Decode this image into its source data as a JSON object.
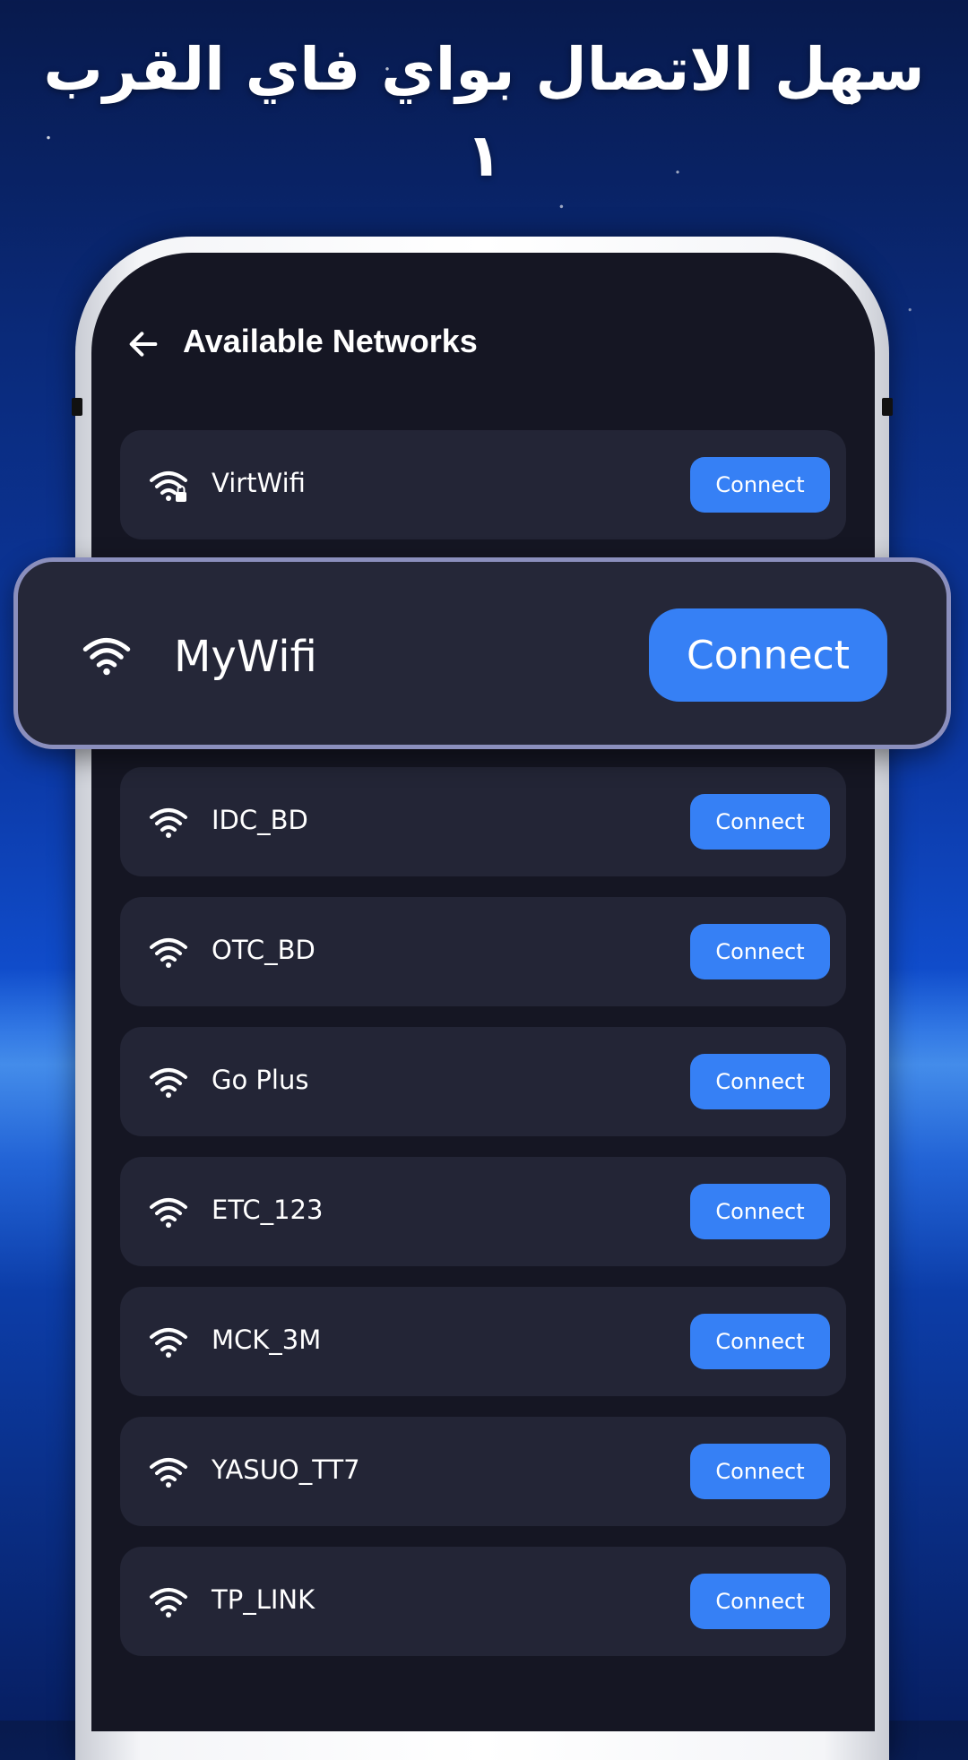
{
  "headline": "سهل الاتصال بواي فاي القرب ١",
  "screen": {
    "title": "Available Networks",
    "back_icon": "arrow-left-icon"
  },
  "featured_network": {
    "name": "MyWifi",
    "icon": "wifi-icon",
    "connect_label": "Connect"
  },
  "networks": [
    {
      "name": "VirtWifi",
      "icon": "wifi-lock-icon",
      "connect_label": "Connect"
    },
    {
      "name": "IDC_BD",
      "icon": "wifi-icon",
      "connect_label": "Connect"
    },
    {
      "name": "OTC_BD",
      "icon": "wifi-icon",
      "connect_label": "Connect"
    },
    {
      "name": "Go Plus",
      "icon": "wifi-icon",
      "connect_label": "Connect"
    },
    {
      "name": "ETC_123",
      "icon": "wifi-icon",
      "connect_label": "Connect"
    },
    {
      "name": "MCK_3M",
      "icon": "wifi-icon",
      "connect_label": "Connect"
    },
    {
      "name": "YASUO_TT7",
      "icon": "wifi-icon",
      "connect_label": "Connect"
    },
    {
      "name": "TP_LINK",
      "icon": "wifi-icon",
      "connect_label": "Connect"
    }
  ],
  "colors": {
    "accent": "#3680f5",
    "card": "#232536",
    "screen_bg": "#151623"
  }
}
